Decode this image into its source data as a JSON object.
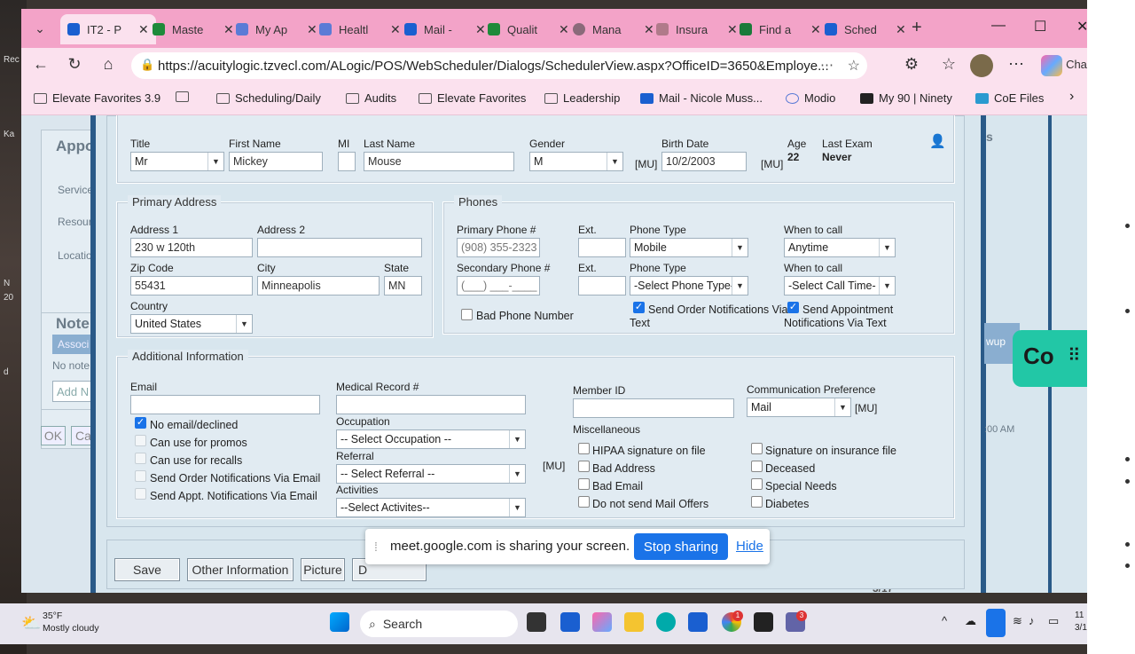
{
  "side_text": {
    "left_1": "Rec",
    "left_2": "Ka",
    "left_3": "N",
    "left_4": "20",
    "left_5": "d"
  },
  "tabs": [
    {
      "label": "IT2 - P",
      "color": "#1a5fd0"
    },
    {
      "label": "Maste",
      "color": "#1e8a3a"
    },
    {
      "label": "My Ap",
      "color": "#5b7bd6"
    },
    {
      "label": "Healtl",
      "color": "#5b7bd6"
    },
    {
      "label": "Mail -",
      "color": "#1a5fd0"
    },
    {
      "label": "Qualit",
      "color": "#1e8a3a"
    },
    {
      "label": "Mana",
      "color": "#8a6a7a"
    },
    {
      "label": "Insura",
      "color": "#b07a8a"
    },
    {
      "label": "Find a",
      "color": "#1a7a3a"
    },
    {
      "label": "Sched",
      "color": "#1a5fd0"
    },
    {
      "label": "Cha",
      "color": "#8a5cd0"
    }
  ],
  "url": "https://acuitylogic.tzvecl.com/ALogic/POS/WebScheduler/Dialogs/SchedulerView.aspx?OfficeID=3650&Employe...",
  "bookmarks": [
    "Elevate Favorites 3.9",
    "",
    "Scheduling/Daily",
    "Audits",
    "Elevate Favorites",
    "Leadership",
    "Mail - Nicole Muss...",
    "Modio",
    "My 90 | Ninety",
    "CoE Files"
  ],
  "left_panel": {
    "title": "Appo",
    "service": "Service",
    "resource": "Resour",
    "location": "Locatio",
    "notes": "Note",
    "assoc": "Associ",
    "no_notes": "No note",
    "add_note": "Add N",
    "ok": "OK",
    "cancel": "Ca"
  },
  "right_panel": {
    "s": "s",
    "wup": "wup",
    "time": ":00 AM",
    "date": "3/17"
  },
  "patient": {
    "title_label": "Title",
    "title_value": "Mr",
    "first_label": "First Name",
    "first_value": "Mickey",
    "mi_label": "MI",
    "mi_value": "",
    "last_label": "Last Name",
    "last_value": "Mouse",
    "gender_label": "Gender",
    "gender_value": "M",
    "mu1": "[MU]",
    "birth_label": "Birth Date",
    "birth_value": "10/2/2003",
    "mu2": "[MU]",
    "age_label": "Age",
    "age_value": "22",
    "last_exam_label": "Last Exam",
    "last_exam_value": "Never"
  },
  "address": {
    "legend": "Primary Address",
    "addr1_label": "Address 1",
    "addr1_value": "230 w 120th",
    "addr2_label": "Address 2",
    "addr2_value": "",
    "zip_label": "Zip Code",
    "zip_value": "55431",
    "city_label": "City",
    "city_value": "Minneapolis",
    "state_label": "State",
    "state_value": "MN",
    "country_label": "Country",
    "country_value": "United States"
  },
  "phones": {
    "legend": "Phones",
    "primary_label": "Primary Phone #",
    "primary_value": "(908) 355-2323",
    "ext_label": "Ext.",
    "ext_value": "",
    "type_label": "Phone Type",
    "type_value": "Mobile",
    "when_label": "When to call",
    "when_value": "Anytime",
    "secondary_label": "Secondary Phone #",
    "secondary_value": "(___) ___-____",
    "ext2_label": "Ext.",
    "type2_label": "Phone Type",
    "type2_value": "-Select Phone Type-",
    "when2_label": "When to call",
    "when2_value": "-Select Call Time-",
    "bad_phone": "Bad Phone Number",
    "send_order_1": "Send Order Notifications Via",
    "send_order_2": "Text",
    "send_appt_1": "Send Appointment",
    "send_appt_2": "Notifications Via Text"
  },
  "additional": {
    "legend": "Additional Information",
    "email_label": "Email",
    "email_value": "",
    "no_email": "No email/declined",
    "promos": "Can use for promos",
    "recalls": "Can use for recalls",
    "send_order_email": "Send Order Notifications Via Email",
    "send_appt_email": "Send Appt. Notifications Via Email",
    "mrn_label": "Medical Record #",
    "mrn_value": "",
    "occupation_label": "Occupation",
    "occupation_value": "-- Select Occupation --",
    "referral_label": "Referral",
    "referral_value": "-- Select Referral --",
    "mu": "[MU]",
    "activities_label": "Activities",
    "activities_value": "--Select Activites--",
    "member_label": "Member ID",
    "member_value": "",
    "comm_label": "Communication Preference",
    "comm_value": "Mail",
    "comm_mu": "[MU]",
    "misc_label": "Miscellaneous",
    "hipaa": "HIPAA signature on file",
    "bad_address": "Bad Address",
    "bad_email": "Bad Email",
    "no_mail": "Do not send Mail Offers",
    "sig_ins": "Signature on insurance file",
    "deceased": "Deceased",
    "special": "Special Needs",
    "diabetes": "Diabetes"
  },
  "buttons": {
    "save": "Save",
    "other": "Other Information",
    "picture": "Picture",
    "d": "D"
  },
  "share": {
    "message": "meet.google.com is sharing your screen.",
    "stop": "Stop sharing",
    "hide": "Hide"
  },
  "copilot": {
    "label": "Co"
  },
  "taskbar": {
    "temp": "35°F",
    "weather": "Mostly cloudy",
    "search": "Search",
    "badge1": "1",
    "badge2": "3",
    "clock1": "11",
    "clock2": "3/1"
  }
}
